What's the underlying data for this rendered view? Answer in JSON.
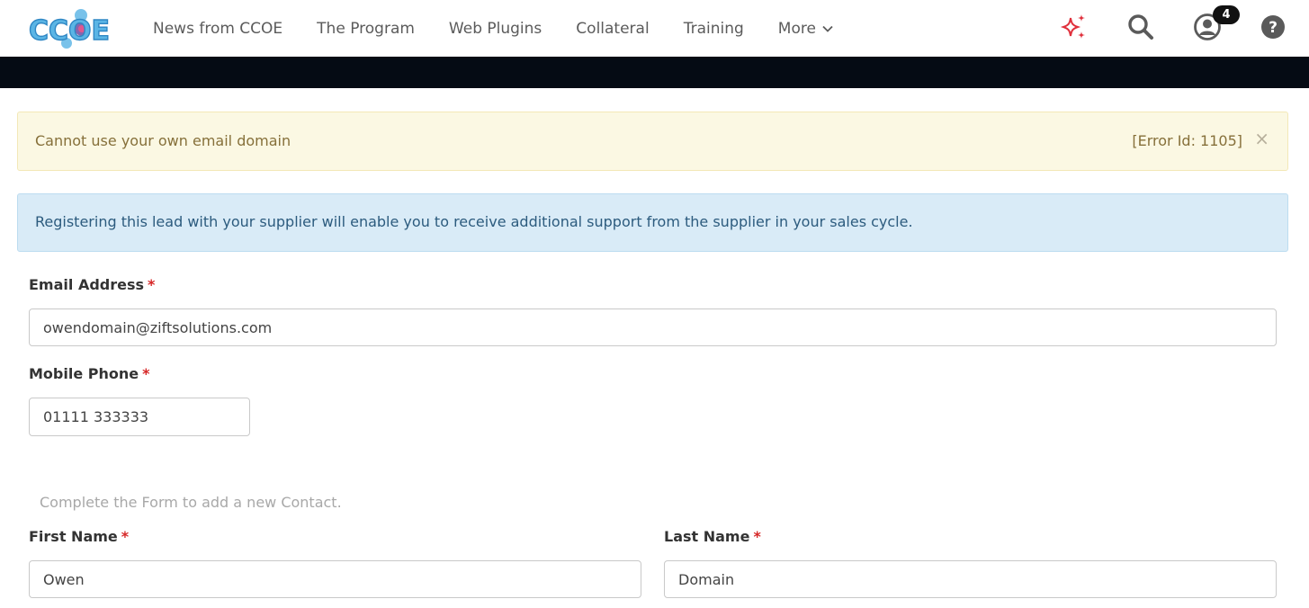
{
  "brand": {
    "logo_text": "CCOE"
  },
  "nav": {
    "items": [
      {
        "label": "News from CCOE"
      },
      {
        "label": "The Program"
      },
      {
        "label": "Web Plugins"
      },
      {
        "label": "Collateral"
      },
      {
        "label": "Training"
      },
      {
        "label": "More"
      }
    ]
  },
  "header_icons": {
    "sparkle": "sparkle-icon",
    "search": "search-icon",
    "user": "user-icon",
    "help": "help-icon",
    "notification_count": "4"
  },
  "alerts": {
    "warning": {
      "message": "Cannot use your own email domain",
      "error_id": "[Error Id: 1105]",
      "close": "×"
    },
    "info": {
      "message": "Registering this lead with your supplier will enable you to receive additional support from the supplier in your sales cycle."
    }
  },
  "form": {
    "email": {
      "label": "Email Address",
      "required": "*",
      "value": "owendomain@ziftsolutions.com"
    },
    "mobile": {
      "label": "Mobile Phone",
      "required": "*",
      "value": "01111 333333"
    },
    "hint": "Complete the Form to add a new Contact.",
    "first_name": {
      "label": "First Name",
      "required": "*",
      "value": "Owen"
    },
    "last_name": {
      "label": "Last Name",
      "required": "*",
      "value": "Domain"
    }
  },
  "colors": {
    "accent_sparkle": "#e0303c",
    "dark_band": "#050b14",
    "warning_bg": "#fbf8e3",
    "info_bg": "#d9ebf7",
    "required": "#d62626"
  }
}
